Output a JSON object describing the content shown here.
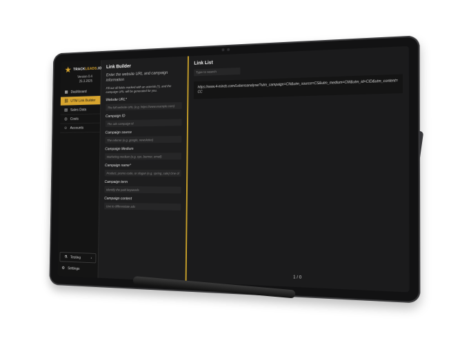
{
  "sidebar": {
    "brand_prefix": "TRACK",
    "brand_accent": "LEADS",
    "brand_suffix": ".IO",
    "version": "Version 0.4",
    "date": "26.3.2025",
    "items": [
      {
        "label": "Dashboard",
        "icon": "dashboard-icon",
        "active": false
      },
      {
        "label": "UTM Link Builder",
        "icon": "link-icon",
        "active": true
      },
      {
        "label": "Sales Data",
        "icon": "chart-icon",
        "active": false
      },
      {
        "label": "Costs",
        "icon": "coin-icon",
        "active": false
      },
      {
        "label": "Accounts",
        "icon": "user-icon",
        "active": false
      }
    ],
    "testing_label": "Testing",
    "settings_label": "Settings"
  },
  "builder": {
    "title": "Link Builder",
    "subtitle": "Enter the website URL and campaign information",
    "hint": "Fill out all fields marked with an asterisk (*), and the campaign URL will be generated for you.",
    "fields": [
      {
        "label": "Website URL*",
        "placeholder": "The full website URL (e.g. https://www.example.com)"
      },
      {
        "label": "Campaign ID",
        "placeholder": "The ads campaign id"
      },
      {
        "label": "Campaign source",
        "placeholder": "The referrer (e.g. google, newsletter)"
      },
      {
        "label": "Campaign Medium",
        "placeholder": "Marketing medium (e.g. cpc, banner, email)"
      },
      {
        "label": "Campaign name*",
        "placeholder": "Product, promo code, or slogan (e.g. spring_sale) One of campai"
      },
      {
        "label": "Campaign term",
        "placeholder": "Identify the paid keywords"
      },
      {
        "label": "Campaign content",
        "placeholder": "Use to differentiate ads"
      }
    ]
  },
  "list": {
    "title": "Link List",
    "search_placeholder": "Type to search",
    "links": [
      "https://www.4-minds.com/Lebensanalyse/?utm_campaign=CN&utm_source=CS&utm_medium=CM&utm_id=CID&utm_content=CC"
    ],
    "pager": "1 / 0"
  },
  "colors": {
    "accent": "#d8a52e",
    "background": "#1a1a1b"
  }
}
